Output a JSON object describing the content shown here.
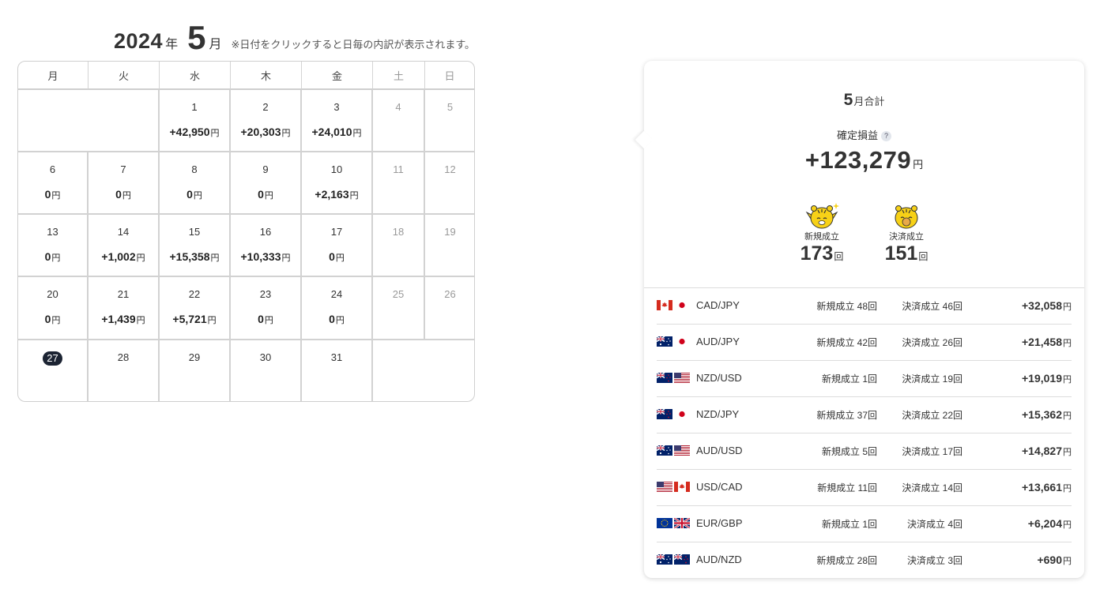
{
  "header": {
    "year": "2024",
    "year_unit": "年",
    "month": "5",
    "month_unit": "月",
    "note": "※日付をクリックすると日毎の内訳が表示されます。"
  },
  "calendar": {
    "weekdays": [
      "月",
      "火",
      "水",
      "木",
      "金",
      "土",
      "日"
    ],
    "yen": "円",
    "weeks": [
      [
        null,
        null,
        {
          "day": "1",
          "amount": "+42,950"
        },
        {
          "day": "2",
          "amount": "+20,303"
        },
        {
          "day": "3",
          "amount": "+24,010"
        },
        {
          "day": "4",
          "amount": ""
        },
        {
          "day": "5",
          "amount": ""
        }
      ],
      [
        {
          "day": "6",
          "amount": "0"
        },
        {
          "day": "7",
          "amount": "0"
        },
        {
          "day": "8",
          "amount": "0"
        },
        {
          "day": "9",
          "amount": "0"
        },
        {
          "day": "10",
          "amount": "+2,163"
        },
        {
          "day": "11",
          "amount": ""
        },
        {
          "day": "12",
          "amount": ""
        }
      ],
      [
        {
          "day": "13",
          "amount": "0"
        },
        {
          "day": "14",
          "amount": "+1,002"
        },
        {
          "day": "15",
          "amount": "+15,358"
        },
        {
          "day": "16",
          "amount": "+10,333"
        },
        {
          "day": "17",
          "amount": "0"
        },
        {
          "day": "18",
          "amount": ""
        },
        {
          "day": "19",
          "amount": ""
        }
      ],
      [
        {
          "day": "20",
          "amount": "0"
        },
        {
          "day": "21",
          "amount": "+1,439"
        },
        {
          "day": "22",
          "amount": "+5,721"
        },
        {
          "day": "23",
          "amount": "0"
        },
        {
          "day": "24",
          "amount": "0"
        },
        {
          "day": "25",
          "amount": ""
        },
        {
          "day": "26",
          "amount": ""
        }
      ],
      [
        {
          "day": "27",
          "amount": "",
          "today": true
        },
        {
          "day": "28",
          "amount": ""
        },
        {
          "day": "29",
          "amount": ""
        },
        {
          "day": "30",
          "amount": ""
        },
        {
          "day": "31",
          "amount": ""
        },
        null,
        null
      ]
    ]
  },
  "summary": {
    "month": "5",
    "title_suffix": "月合計",
    "profit_label": "確定損益",
    "help": "?",
    "total_profit": "+123,279",
    "yen": "円",
    "new_label": "新規成立",
    "new_count": "173",
    "settle_label": "決済成立",
    "settle_count": "151",
    "count_unit": "回"
  },
  "pairs": [
    {
      "name": "CAD/JPY",
      "flags": [
        "ca-flag-icon",
        "jp-flag-icon"
      ],
      "new": "新規成立 48回",
      "settle": "決済成立 46回",
      "amount": "+32,058"
    },
    {
      "name": "AUD/JPY",
      "flags": [
        "au-flag-icon",
        "jp-flag-icon"
      ],
      "new": "新規成立 42回",
      "settle": "決済成立 26回",
      "amount": "+21,458"
    },
    {
      "name": "NZD/USD",
      "flags": [
        "nz-flag-icon",
        "us-flag-icon"
      ],
      "new": "新規成立 1回",
      "settle": "決済成立 19回",
      "amount": "+19,019"
    },
    {
      "name": "NZD/JPY",
      "flags": [
        "nz-flag-icon",
        "jp-flag-icon"
      ],
      "new": "新規成立 37回",
      "settle": "決済成立 22回",
      "amount": "+15,362"
    },
    {
      "name": "AUD/USD",
      "flags": [
        "au-flag-icon",
        "us-flag-icon"
      ],
      "new": "新規成立 5回",
      "settle": "決済成立 17回",
      "amount": "+14,827"
    },
    {
      "name": "USD/CAD",
      "flags": [
        "us-flag-icon",
        "ca-flag-icon"
      ],
      "new": "新規成立 11回",
      "settle": "決済成立 14回",
      "amount": "+13,661"
    },
    {
      "name": "EUR/GBP",
      "flags": [
        "eu-flag-icon",
        "gb-flag-icon"
      ],
      "new": "新規成立 1回",
      "settle": "決済成立 4回",
      "amount": "+6,204"
    },
    {
      "name": "AUD/NZD",
      "flags": [
        "au-flag-icon",
        "nz-flag-icon"
      ],
      "new": "新規成立 28回",
      "settle": "決済成立 3回",
      "amount": "+690"
    }
  ],
  "colors": {
    "today_badge": "#1c2433",
    "tiger_yellow": "#f7d117",
    "border": "#d2d2d2"
  }
}
